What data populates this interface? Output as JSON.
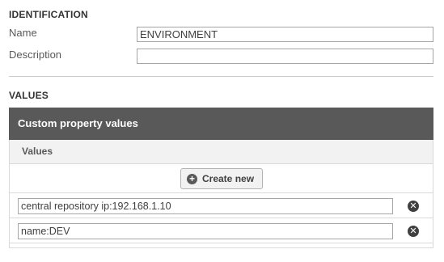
{
  "identification": {
    "heading": "IDENTIFICATION",
    "name_label": "Name",
    "name_value": "ENVIRONMENT",
    "description_label": "Description",
    "description_value": ""
  },
  "values": {
    "heading": "VALUES",
    "panel_title": "Custom property values",
    "column_header": "Values",
    "create_button_label": "Create new",
    "create_icon": "plus-circle-icon",
    "remove_icon": "close-circle-icon",
    "items": [
      {
        "value": "central repository ip:192.168.1.10"
      },
      {
        "value": "name:DEV"
      }
    ]
  },
  "colors": {
    "panel_header_bg": "#595959",
    "subheader_bg": "#f2f2f2",
    "border": "#d9d9d9"
  }
}
